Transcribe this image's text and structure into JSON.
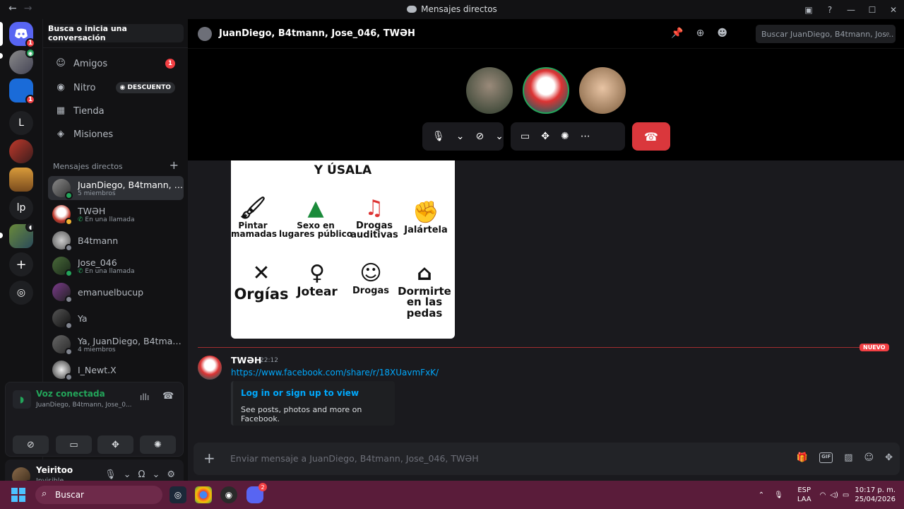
{
  "titlebar": {
    "title": "Mensajes directos",
    "back": "←",
    "forward": "→"
  },
  "sidebar": {
    "search_label": "Busca o inicia una conversación",
    "nav": [
      {
        "label": "Amigos",
        "badge": "1",
        "icon": "friends-icon"
      },
      {
        "label": "Nitro",
        "tag": "DESCUENTO",
        "tag_glyph": "◉",
        "icon": "nitro-icon"
      },
      {
        "label": "Tienda",
        "icon": "store-icon"
      },
      {
        "label": "Misiones",
        "icon": "quests-icon"
      }
    ],
    "dm_header": "Mensajes directos",
    "dm_add": "+",
    "dms": [
      {
        "name": "JuanDiego, B4tmann, J...",
        "sub": "5 miembros"
      },
      {
        "name": "TWƏH",
        "sub": "En una llamada"
      },
      {
        "name": "B4tmann",
        "sub": ""
      },
      {
        "name": "Jose_046",
        "sub": "En una llamada"
      },
      {
        "name": "emanuelbucup",
        "sub": ""
      },
      {
        "name": "Ya",
        "sub": ""
      },
      {
        "name": "Ya, JuanDiego, B4tmann",
        "sub": "4 miembros"
      },
      {
        "name": "I_Newt.X",
        "sub": ""
      }
    ],
    "voice": {
      "status": "Voz conectada",
      "channel": "JuanDiego, B4tmann, Jose_0..."
    },
    "user": {
      "name": "Yeiritoo",
      "status": "Invisible"
    }
  },
  "servers": {
    "badges": [
      "1",
      "1"
    ],
    "letters": [
      "L",
      "lp"
    ],
    "add": "+"
  },
  "chat": {
    "title": "JuanDiego, B4tmann, Jose_046, TWƏH",
    "search_placeholder": "Buscar JuanDiego, B4tmann, Jos...",
    "image": {
      "heading": "Y ÚSALA",
      "cells": [
        "Pintar mamadas",
        "Sexo en lugares público",
        "Drogas auditivas",
        "Jalártela",
        "Orgías",
        "Jotear",
        "Drogas",
        "Dormirte en las pedas"
      ]
    },
    "new_tag": "NUEVO",
    "message": {
      "author": "TWƏH",
      "time": "22:12",
      "link": "https://www.facebook.com/share/r/18XUavmFxK/",
      "embed_title": "Log in or sign up to view",
      "embed_desc": "See posts, photos and more on Facebook."
    },
    "composer_placeholder": "Enviar mensaje a JuanDiego, B4tmann, Jose_046, TWƏH",
    "gif_label": "GIF"
  },
  "taskbar": {
    "search": "Buscar",
    "lang_top": "ESP",
    "lang_bottom": "LAA",
    "time": "10:17 p. m.",
    "date": "25/04/2026",
    "discord_badge": "2"
  },
  "colors": {
    "accent": "#5865f2",
    "danger": "#da373c",
    "online": "#23a55a",
    "link": "#00a8fc",
    "taskbar": "#5a1c3a"
  }
}
